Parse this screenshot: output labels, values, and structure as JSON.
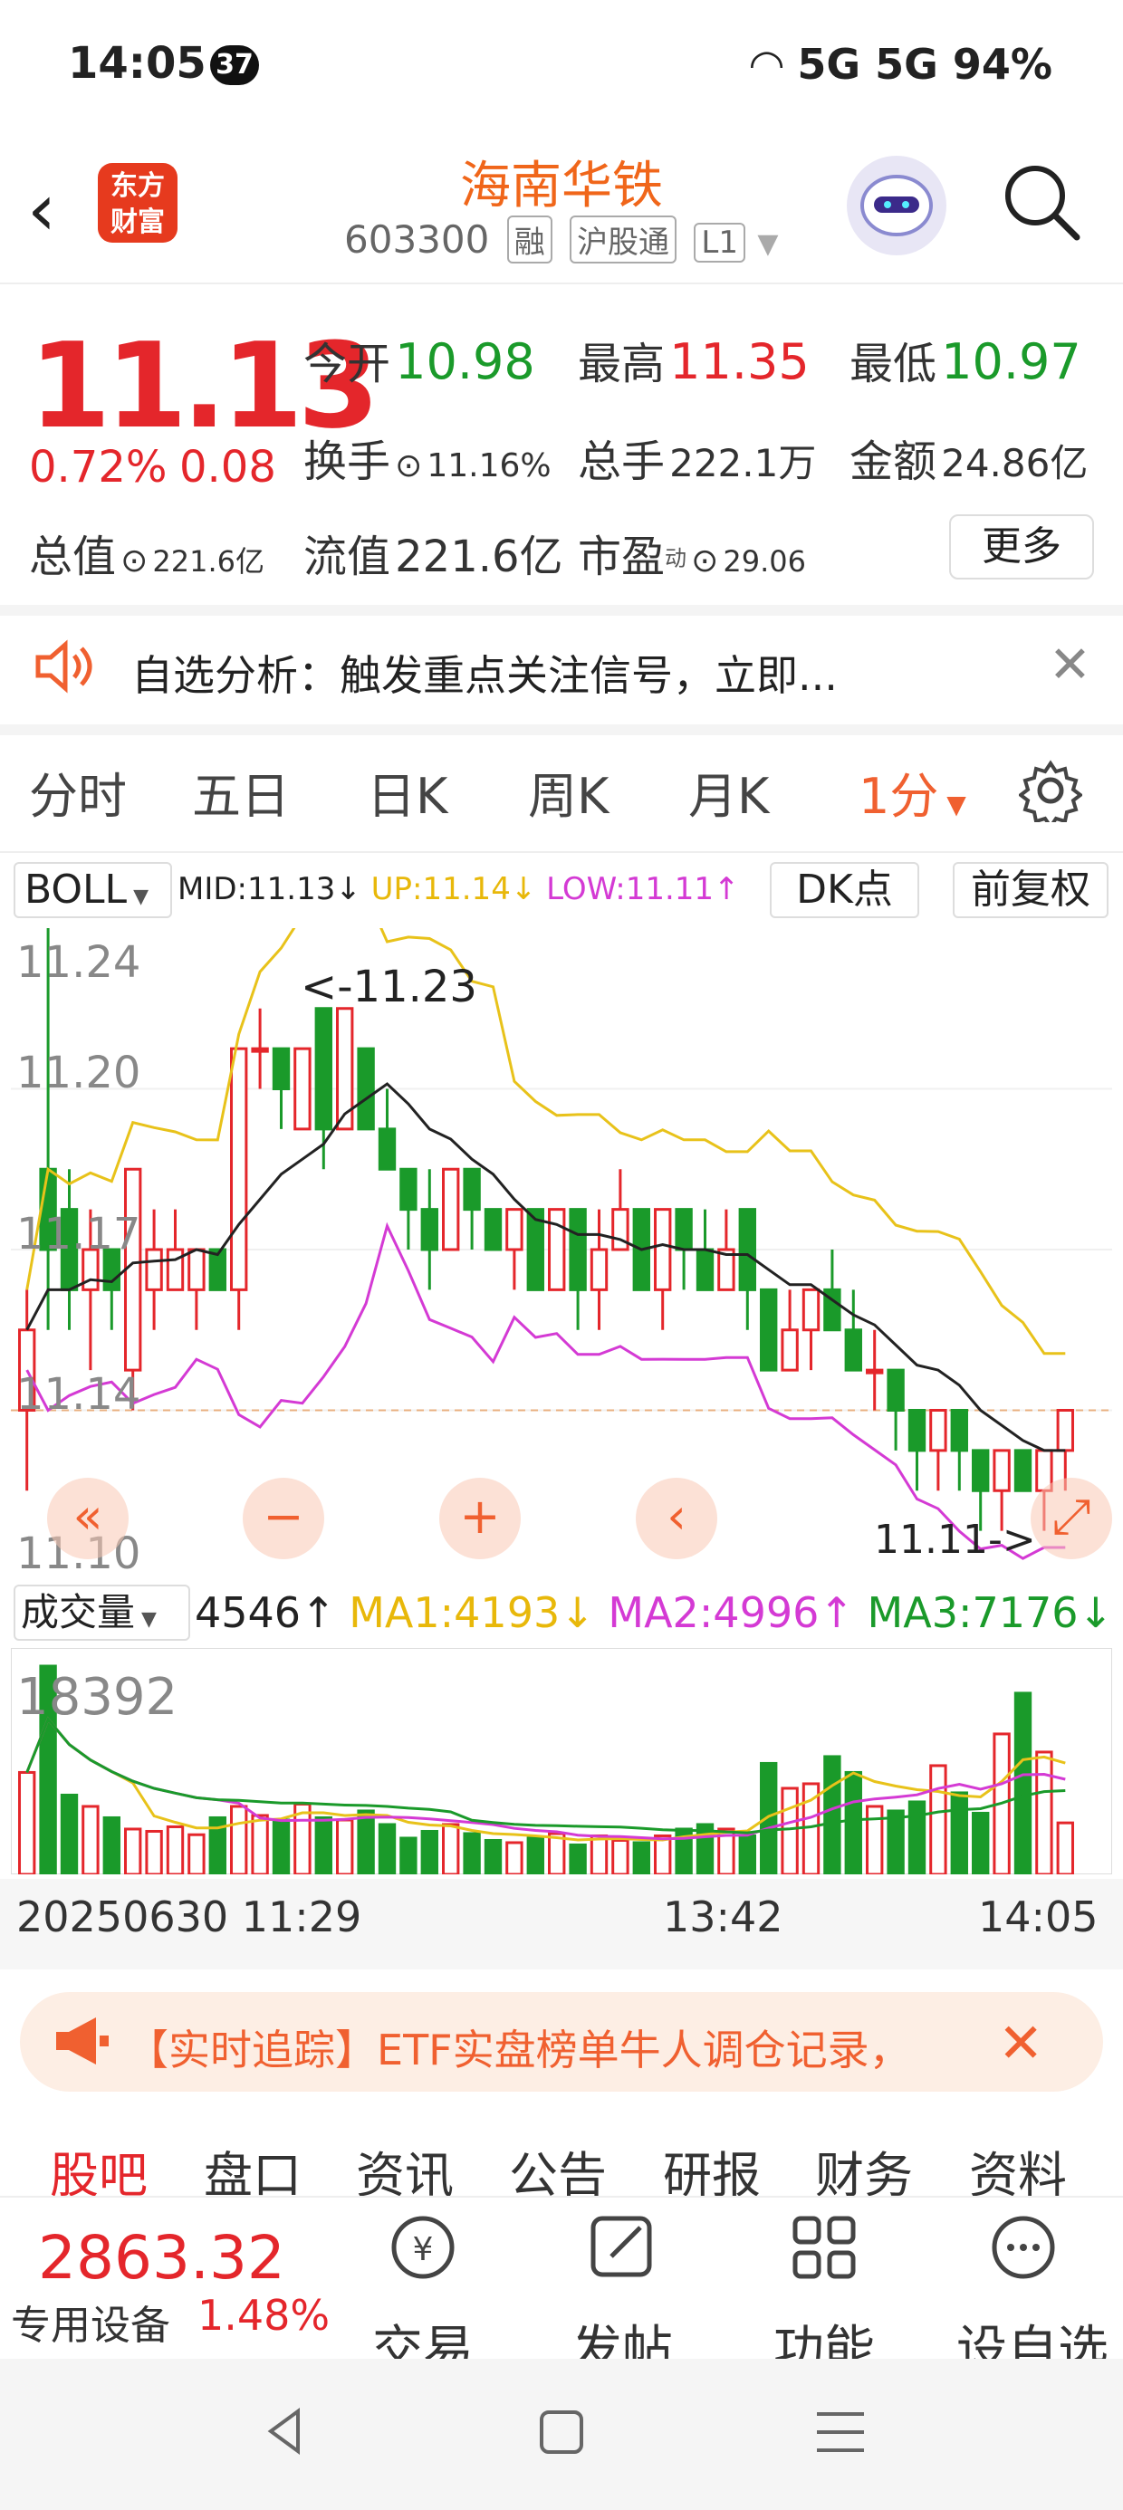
{
  "status": {
    "time": "14:05",
    "badge": "37",
    "right": "5G 5G 94%"
  },
  "header": {
    "title": "海南华铁",
    "code": "603300",
    "tags": [
      "融",
      "沪股通",
      "L1"
    ],
    "logo_line1": "东方",
    "logo_line2": "财富"
  },
  "quote": {
    "price": "11.13",
    "pct": "0.72%",
    "chg": "0.08",
    "open_label": "今开",
    "open": "10.98",
    "high_label": "最高",
    "high": "11.35",
    "low_label": "最低",
    "low": "10.97",
    "turnover_label": "换手",
    "turnover": "11.16%",
    "volume_label": "总手",
    "volume": "222.1万",
    "amount_label": "金额",
    "amount": "24.86亿",
    "mktcap_label": "总值",
    "mktcap": "221.6亿",
    "float_label": "流值",
    "float": "221.6亿",
    "pe_label": "市盈",
    "pe_sup": "动",
    "pe": "29.06",
    "more": "更多"
  },
  "notice": {
    "text": "自选分析：触发重点关注信号，立即..."
  },
  "tabs": [
    "分时",
    "五日",
    "日K",
    "周K",
    "月K",
    "1分"
  ],
  "chart": {
    "indicator": "BOLL",
    "mid": "MID:11.13↓",
    "up": "UP:11.14↓",
    "low": "LOW:11.11↑",
    "dk": "DK点",
    "adjust": "前复权",
    "y_labels": [
      "11.24",
      "11.20",
      "11.17",
      "11.14",
      "11.10"
    ],
    "high_marker": "<-11.23",
    "low_marker": "11.11->",
    "vol_label": "成交量",
    "vol": "4546↑",
    "ma1": "MA1:4193↓",
    "ma2": "MA2:4996↑",
    "ma3": "MA3:7176↓",
    "vol_max": "18392",
    "x_labels": [
      "20250630 11:29",
      "13:42",
      "14:05"
    ],
    "colors": {
      "up": "#e4262b",
      "down": "#1a9a2a",
      "upper": "#e8c21a",
      "mid": "#222222",
      "lower": "#d43ad4"
    }
  },
  "chart_data": {
    "type": "candlestick",
    "y_range": [
      11.09,
      11.25
    ],
    "candles": [
      [
        11.13,
        11.15,
        11.11,
        11.16
      ],
      [
        11.19,
        11.17,
        11.15,
        11.25
      ],
      [
        11.18,
        11.16,
        11.15,
        11.19
      ],
      [
        11.16,
        11.17,
        11.14,
        11.18
      ],
      [
        11.17,
        11.16,
        11.15,
        11.17
      ],
      [
        11.14,
        11.19,
        11.13,
        11.19
      ],
      [
        11.16,
        11.17,
        11.15,
        11.18
      ],
      [
        11.16,
        11.17,
        11.16,
        11.18
      ],
      [
        11.16,
        11.17,
        11.15,
        11.17
      ],
      [
        11.17,
        11.16,
        11.16,
        11.17
      ],
      [
        11.16,
        11.22,
        11.15,
        11.22
      ],
      [
        11.22,
        11.22,
        11.21,
        11.23
      ],
      [
        11.22,
        11.21,
        11.2,
        11.22
      ],
      [
        11.2,
        11.22,
        11.2,
        11.22
      ],
      [
        11.23,
        11.2,
        11.19,
        11.23
      ],
      [
        11.2,
        11.23,
        11.2,
        11.23
      ],
      [
        11.22,
        11.2,
        11.2,
        11.22
      ],
      [
        11.2,
        11.19,
        11.19,
        11.21
      ],
      [
        11.19,
        11.18,
        11.17,
        11.19
      ],
      [
        11.18,
        11.17,
        11.16,
        11.19
      ],
      [
        11.17,
        11.19,
        11.17,
        11.19
      ],
      [
        11.19,
        11.18,
        11.17,
        11.19
      ],
      [
        11.18,
        11.17,
        11.17,
        11.18
      ],
      [
        11.17,
        11.18,
        11.16,
        11.18
      ],
      [
        11.18,
        11.16,
        11.16,
        11.18
      ],
      [
        11.16,
        11.18,
        11.16,
        11.18
      ],
      [
        11.18,
        11.16,
        11.15,
        11.18
      ],
      [
        11.16,
        11.17,
        11.15,
        11.18
      ],
      [
        11.17,
        11.18,
        11.17,
        11.19
      ],
      [
        11.18,
        11.16,
        11.16,
        11.18
      ],
      [
        11.16,
        11.18,
        11.15,
        11.18
      ],
      [
        11.18,
        11.17,
        11.16,
        11.18
      ],
      [
        11.17,
        11.16,
        11.16,
        11.18
      ],
      [
        11.16,
        11.17,
        11.16,
        11.18
      ],
      [
        11.18,
        11.16,
        11.15,
        11.18
      ],
      [
        11.16,
        11.14,
        11.14,
        11.16
      ],
      [
        11.14,
        11.15,
        11.14,
        11.16
      ],
      [
        11.15,
        11.16,
        11.14,
        11.16
      ],
      [
        11.16,
        11.15,
        11.15,
        11.17
      ],
      [
        11.15,
        11.14,
        11.14,
        11.16
      ],
      [
        11.14,
        11.14,
        11.13,
        11.15
      ],
      [
        11.14,
        11.13,
        11.12,
        11.14
      ],
      [
        11.13,
        11.12,
        11.11,
        11.13
      ],
      [
        11.12,
        11.13,
        11.11,
        11.13
      ],
      [
        11.13,
        11.12,
        11.11,
        11.13
      ],
      [
        11.12,
        11.11,
        11.1,
        11.12
      ],
      [
        11.11,
        11.12,
        11.1,
        11.12
      ],
      [
        11.12,
        11.11,
        11.11,
        11.12
      ],
      [
        11.11,
        11.12,
        11.1,
        11.12
      ],
      [
        11.12,
        11.13,
        11.11,
        11.13
      ]
    ],
    "volumes": [
      9000,
      18392,
      7000,
      6000,
      5000,
      4000,
      3800,
      4200,
      3500,
      5000,
      6000,
      5200,
      4800,
      6200,
      5000,
      4800,
      5600,
      4400,
      3200,
      3800,
      4400,
      3600,
      3000,
      2800,
      3200,
      3600,
      2600,
      3400,
      3000,
      2800,
      3400,
      4000,
      4400,
      4000,
      3400,
      9800,
      7600,
      8000,
      10400,
      9000,
      6000,
      5600,
      6400,
      9600,
      7200,
      5400,
      12400,
      16000,
      10800,
      4546
    ],
    "x_labels": [
      "20250630 11:29",
      "13:42",
      "14:05"
    ]
  },
  "promo": {
    "text": "【实时追踪】ETF实盘榜单牛人调仓记录，"
  },
  "subtabs": [
    "股吧",
    "盘口",
    "资讯",
    "公告",
    "研报",
    "财务",
    "资料"
  ],
  "bottom": {
    "index_value": "2863.32",
    "index_name": "专用设备",
    "index_pct": "1.48%",
    "items": [
      "交易",
      "发帖",
      "功能",
      "设自选"
    ]
  }
}
